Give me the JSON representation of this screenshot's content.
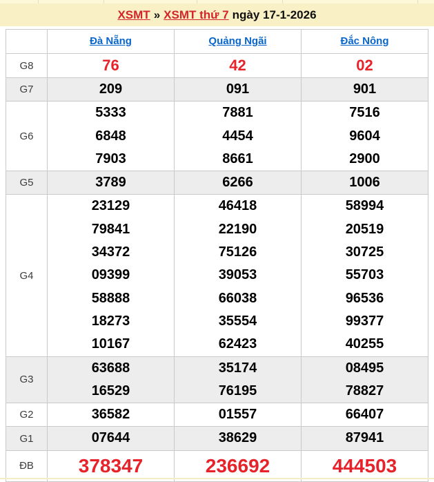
{
  "colors": {
    "accent_red": "#e6232b",
    "link_blue": "#0966cc",
    "band_yellow": "#faf0c5",
    "shade_gray": "#ededed",
    "border_gray": "#c9c9c9"
  },
  "header": {
    "link_xsmt": "XSMT",
    "separator": "»",
    "link_day": "XSMT thứ 7",
    "date_text": "ngày 17-1-2026"
  },
  "table": {
    "columns": [
      "Đà Nẵng",
      "Quảng Ngãi",
      "Đắc Nông"
    ],
    "rows": [
      {
        "label": "G8",
        "style": "g8",
        "shade": false,
        "cells": [
          [
            "76"
          ],
          [
            "42"
          ],
          [
            "02"
          ]
        ]
      },
      {
        "label": "G7",
        "style": "",
        "shade": true,
        "cells": [
          [
            "209"
          ],
          [
            "091"
          ],
          [
            "901"
          ]
        ]
      },
      {
        "label": "G6",
        "style": "",
        "shade": false,
        "cells": [
          [
            "5333",
            "6848",
            "7903"
          ],
          [
            "7881",
            "4454",
            "8661"
          ],
          [
            "7516",
            "9604",
            "2900"
          ]
        ]
      },
      {
        "label": "G5",
        "style": "",
        "shade": true,
        "cells": [
          [
            "3789"
          ],
          [
            "6266"
          ],
          [
            "1006"
          ]
        ]
      },
      {
        "label": "G4",
        "style": "",
        "shade": false,
        "cells": [
          [
            "23129",
            "79841",
            "34372",
            "09399",
            "58888",
            "18273",
            "10167"
          ],
          [
            "46418",
            "22190",
            "75126",
            "39053",
            "66038",
            "35554",
            "62423"
          ],
          [
            "58994",
            "20519",
            "30725",
            "55703",
            "96536",
            "99377",
            "40255"
          ]
        ]
      },
      {
        "label": "G3",
        "style": "",
        "shade": true,
        "cells": [
          [
            "63688",
            "16529"
          ],
          [
            "35174",
            "76195"
          ],
          [
            "08495",
            "78827"
          ]
        ]
      },
      {
        "label": "G2",
        "style": "",
        "shade": false,
        "cells": [
          [
            "36582"
          ],
          [
            "01557"
          ],
          [
            "66407"
          ]
        ]
      },
      {
        "label": "G1",
        "style": "",
        "shade": true,
        "cells": [
          [
            "07644"
          ],
          [
            "38629"
          ],
          [
            "87941"
          ]
        ]
      },
      {
        "label": "ĐB",
        "style": "db",
        "shade": false,
        "cells": [
          [
            "378347"
          ],
          [
            "236692"
          ],
          [
            "444503"
          ]
        ]
      }
    ]
  }
}
